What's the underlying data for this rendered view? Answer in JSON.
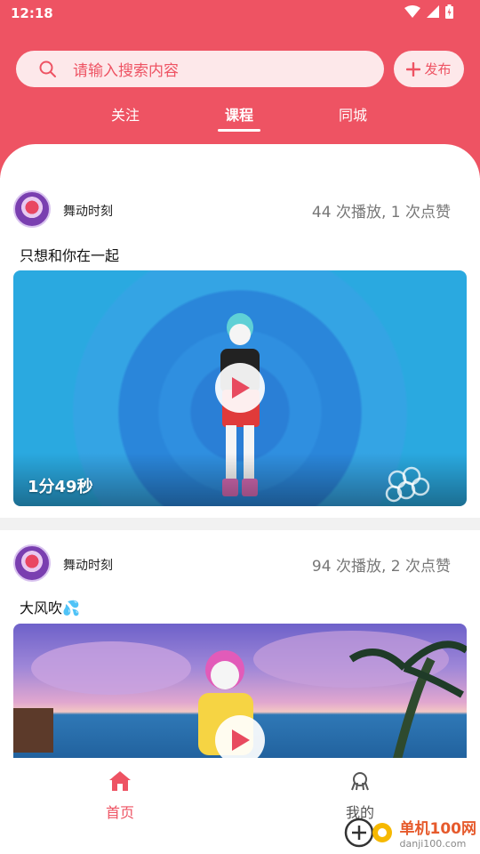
{
  "status_bar": {
    "time": "12:18"
  },
  "search": {
    "placeholder": "请输入搜索内容",
    "publish_label": "发布"
  },
  "tabs": [
    {
      "label": "关注",
      "active": false
    },
    {
      "label": "课程",
      "active": true
    },
    {
      "label": "同城",
      "active": false
    }
  ],
  "posts": [
    {
      "author": "舞动时刻",
      "stats": "44 次播放, 1 次点赞",
      "title": "只想和你在一起",
      "duration": "1分49秒"
    },
    {
      "author": "舞动时刻",
      "stats": "94 次播放, 2 次点赞",
      "title": "大风吹💦"
    }
  ],
  "bottom_nav": [
    {
      "label": "首页",
      "icon": "home-icon",
      "active": true
    },
    {
      "label": "我的",
      "icon": "profile-icon",
      "active": false
    }
  ],
  "colors": {
    "accent": "#ee5363",
    "tab_bg": "#fde8ea"
  },
  "watermark": {
    "name": "单机100网",
    "url": "danji100.com"
  }
}
